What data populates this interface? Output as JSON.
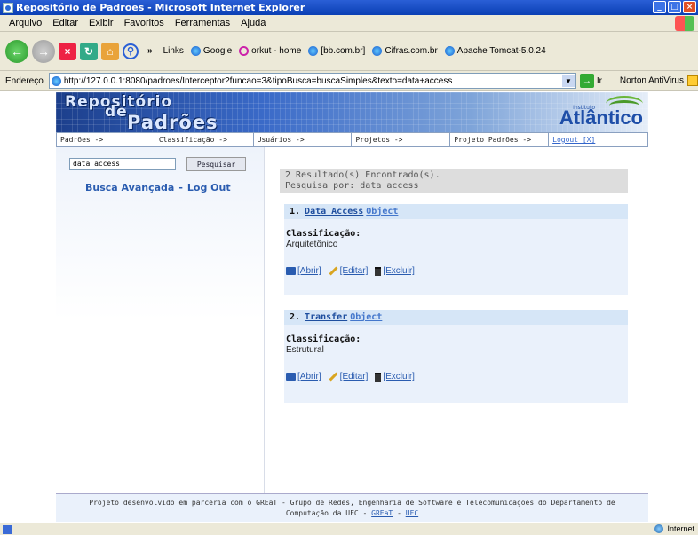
{
  "window": {
    "title": "Repositório de Padrões - Microsoft Internet Explorer"
  },
  "menu": [
    "Arquivo",
    "Editar",
    "Exibir",
    "Favoritos",
    "Ferramentas",
    "Ajuda"
  ],
  "toolbar": {
    "chevron": "»",
    "links_label": "Links",
    "links": [
      "Google",
      "orkut - home",
      "[bb.com.br]",
      "Cifras.com.br",
      "Apache Tomcat-5.0.24"
    ]
  },
  "address": {
    "label": "Endereço",
    "url": "http://127.0.0.1:8080/padroes/Interceptor?funcao=3&tipoBusca=buscaSimples&texto=data+access",
    "go_label": "Ir",
    "norton": "Norton AntiVirus"
  },
  "banner": {
    "logo_line1": "Repositório",
    "logo_line2": "de",
    "logo_line3": "Padrões",
    "brand": "Atlântico",
    "brand_sub": "Instituto"
  },
  "nav": {
    "items": [
      "Padrões ->",
      "Classificação ->",
      "Usuários ->",
      "Projetos ->",
      "Projeto Padrões ->",
      "Logout [X]"
    ]
  },
  "search": {
    "value": "data access",
    "button": "Pesquisar",
    "advanced": "Busca Avançada",
    "separator": "-",
    "logout": "Log Out"
  },
  "results": {
    "count_text": "2 Resultado(s) Encontrado(s).",
    "query_text": "Pesquisa por: data access",
    "items": [
      {
        "number": "1.",
        "name_part1": "Data Access",
        "name_part2": "Object",
        "class_label": "Classificação:",
        "class_value": "Arquitetônico",
        "actions": [
          "[Abrir]",
          "[Editar]",
          "[Excluir]"
        ]
      },
      {
        "number": "2.",
        "name_part1": "Transfer",
        "name_part2": "Object",
        "class_label": "Classificação:",
        "class_value": "Estrutural",
        "actions": [
          "[Abrir]",
          "[Editar]",
          "[Excluir]"
        ]
      }
    ]
  },
  "footer": {
    "line1": "Projeto desenvolvido em parceria com o GREaT - Grupo de Redes, Engenharia de Software e Telecomunicações do Departamento de",
    "line2_prefix": "Computação da UFC - ",
    "link1": "GREaT",
    "link_sep": " - ",
    "link2": "UFC"
  },
  "status": {
    "zone": "Internet"
  }
}
